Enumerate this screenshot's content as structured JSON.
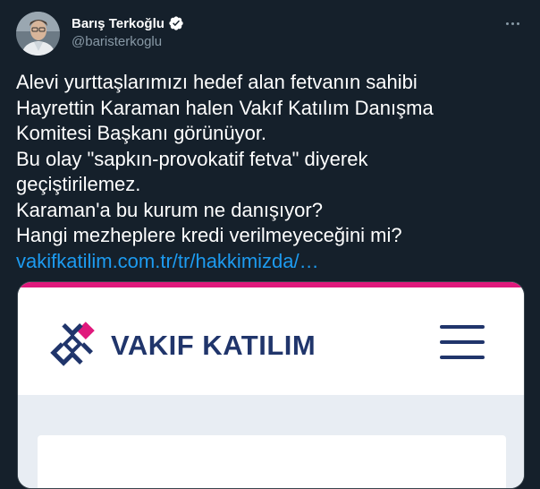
{
  "author": {
    "display_name": "Barış Terkoğlu",
    "handle": "@baristerkoglu",
    "verified": true,
    "avatar_icon": "profile-photo"
  },
  "menu": {
    "icon": "more-dots-icon"
  },
  "tweet": {
    "lines": [
      "Alevi yurttaşlarımızı hedef alan fetvanın sahibi",
      "Hayrettin Karaman halen Vakıf Katılım Danışma",
      "Komitesi Başkanı görünüyor.",
      "Bu olay \"sapkın-provokatif fetva\" diyerek",
      "geçiştirilemez.",
      "Karaman'a bu kurum ne danışıyor?",
      "Hangi mezheplere kredi verilmeyeceğini mi?"
    ],
    "link_text": "vakifkatilim.com.tr/tr/hakkimizda/…"
  },
  "card": {
    "brand_name": "VAKIF KATILIM",
    "menu_icon": "hamburger-icon",
    "colors": {
      "accent": "#e0197c",
      "brand": "#20356b",
      "body_bg": "#e8edf3"
    }
  },
  "colors": {
    "background": "#15202b",
    "link": "#1d9bf0",
    "secondary_text": "#8899a6",
    "verified": "#1d9bf0"
  }
}
